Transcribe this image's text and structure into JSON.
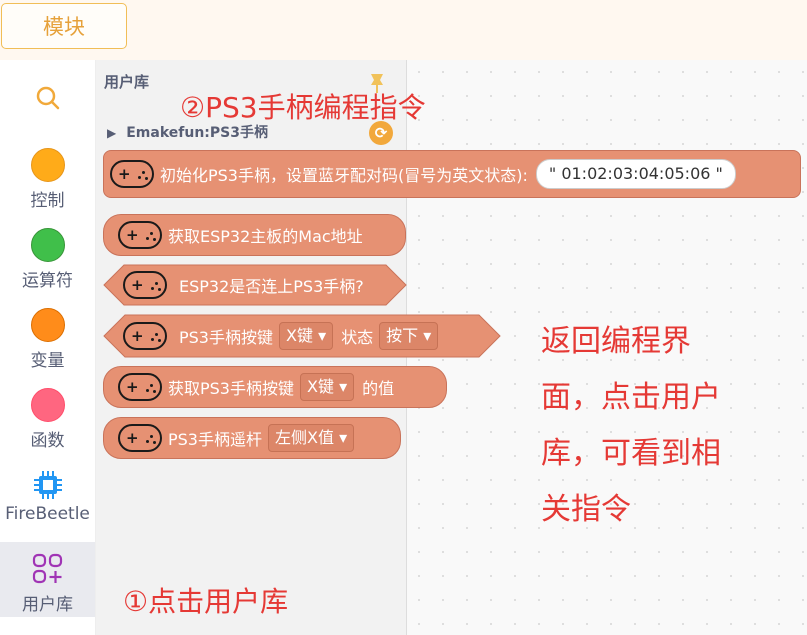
{
  "topbar": {
    "module_tab": "模块"
  },
  "sidebar": {
    "items": [
      {
        "label": "控制",
        "color": "#ffab19"
      },
      {
        "label": "运算符",
        "color": "#40bf4a"
      },
      {
        "label": "变量",
        "color": "#ff8c1a"
      },
      {
        "label": "函数",
        "color": "#ff6680"
      },
      {
        "label": "FireBeetle",
        "color": "#2196f3"
      },
      {
        "label": "用户库",
        "color": "#a034b5"
      }
    ]
  },
  "flyout": {
    "title": "用户库",
    "category": "Emakefun:PS3手柄",
    "blocks": {
      "init": {
        "text": "初始化PS3手柄，设置蓝牙配对码(冒号为英文状态):",
        "value": "\" 01:02:03:04:05:06 \""
      },
      "mac": {
        "text": "获取ESP32主板的Mac地址"
      },
      "connected": {
        "text": "ESP32是否连上PS3手柄?"
      },
      "button_state": {
        "text": "PS3手柄按键",
        "key": "X键",
        "state_label": "状态",
        "state": "按下"
      },
      "button_value": {
        "text": "获取PS3手柄按键",
        "key": "X键",
        "suffix": "的值"
      },
      "joystick": {
        "text": "PS3手柄遥杆",
        "axis": "左侧X值"
      }
    }
  },
  "annotations": {
    "step2": "②PS3手柄编程指令",
    "step1": "①点击用户库",
    "note_lines": [
      "返回编程界",
      "面，点击用户",
      "库，可看到相",
      "关指令"
    ]
  }
}
